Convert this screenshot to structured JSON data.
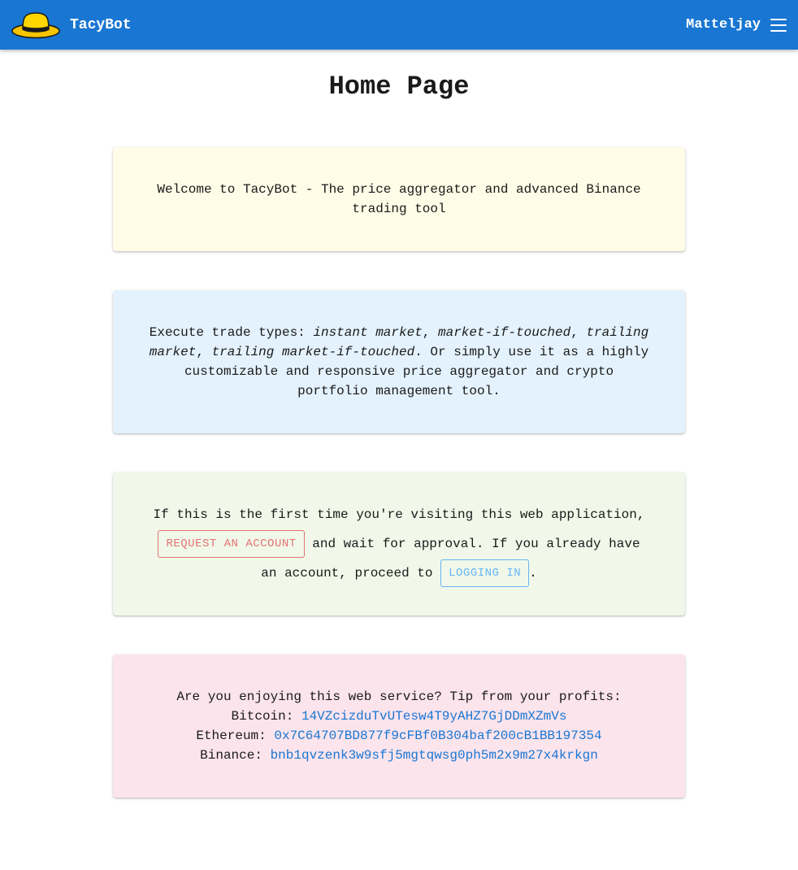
{
  "header": {
    "brand": "TacyBot",
    "username": "Matteljay",
    "logo_icon": "hat-icon",
    "menu_icon": "hamburger-menu-icon"
  },
  "page": {
    "title": "Home Page"
  },
  "welcome": {
    "text": "Welcome to TacyBot - The price aggregator and advanced Binance trading tool"
  },
  "trade": {
    "prefix": "Execute trade types: ",
    "type1": "instant market",
    "sep1": ", ",
    "type2": "market-if-touched",
    "sep2": ", ",
    "type3": "trailing market",
    "sep3": ", ",
    "type4": "trailing market-if-touched",
    "suffix": ". Or simply use it as a highly customizable and responsive price aggregator and crypto portfolio management tool."
  },
  "account": {
    "text1": "If this is the first time you're visiting this web application, ",
    "request_button": "REQUEST AN ACCOUNT",
    "text2": " and wait for approval. If you already have an account, proceed to ",
    "login_button": "LOGGING IN",
    "text3": "."
  },
  "tip": {
    "intro": "Are you enjoying this web service? Tip from your profits:",
    "bitcoin_label": "Bitcoin: ",
    "bitcoin_address": "14VZcizduTvUTesw4T9yAHZ7GjDDmXZmVs",
    "ethereum_label": "Ethereum: ",
    "ethereum_address": "0x7C64707BD877f9cFBf0B304baf200cB1BB197354",
    "binance_label": "Binance: ",
    "binance_address": "bnb1qvzenk3w9sfj5mgtqwsg0ph5m2x9m27x4krkgn"
  },
  "colors": {
    "topbar": "#1976d2",
    "welcome_bg": "#fffde7",
    "trade_bg": "#e3f2fd",
    "account_bg": "#f1f8e9",
    "tip_bg": "#fce4ec",
    "request_button": "#e57373",
    "login_button": "#64b5f6",
    "link": "#1976d2"
  }
}
